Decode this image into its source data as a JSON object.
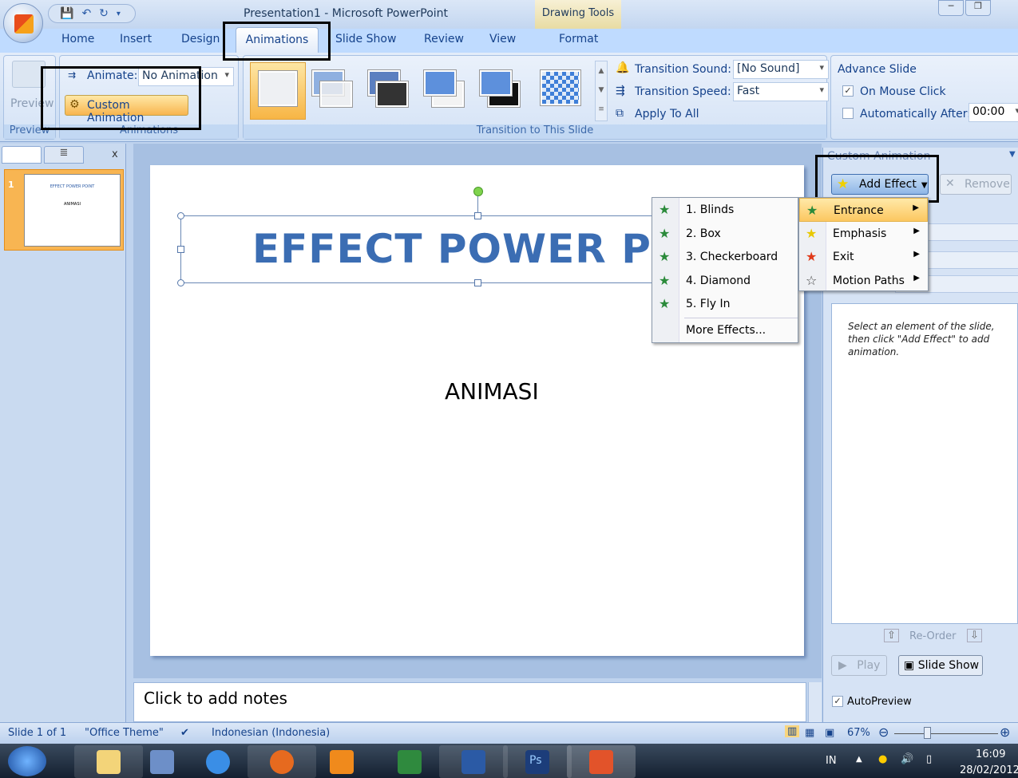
{
  "window": {
    "title": "Presentation1 - Microsoft PowerPoint",
    "contextual_tab_group": "Drawing Tools",
    "minimize": "─",
    "restore": "❐"
  },
  "tabs": [
    "Home",
    "Insert",
    "Design",
    "Animations",
    "Slide Show",
    "Review",
    "View",
    "Format"
  ],
  "active_tab": "Animations",
  "ribbon": {
    "preview": {
      "button": "Preview",
      "group": "Preview"
    },
    "animations": {
      "animate_label": "Animate:",
      "animate_value": "No Animation",
      "custom_animation": "Custom Animation",
      "group": "Animations"
    },
    "transition": {
      "sound_label": "Transition Sound:",
      "sound_value": "[No Sound]",
      "speed_label": "Transition Speed:",
      "speed_value": "Fast",
      "apply_all": "Apply To All",
      "group": "Transition to This Slide"
    },
    "advance": {
      "title": "Advance Slide",
      "on_mouse_click": "On Mouse Click",
      "on_mouse_click_checked": true,
      "auto_after": "Automatically After:",
      "auto_after_checked": false,
      "auto_time": "00:00"
    }
  },
  "slides_panel": {
    "close": "x",
    "slide_number": "1",
    "thumb_title": "EFFECT POWER POINT",
    "thumb_sub": "ANIMASI"
  },
  "slide": {
    "title": "EFFECT POWER POINT",
    "subtitle": "ANIMASI"
  },
  "notes": {
    "placeholder": "Click to add notes"
  },
  "task_pane": {
    "title": "Custom Animation",
    "add_effect": "Add Effect",
    "remove": "Remove",
    "hint": "Select an element of the slide, then click \"Add Effect\" to add animation.",
    "reorder": "Re-Order",
    "play": "Play",
    "slide_show": "Slide Show",
    "autopreview": "AutoPreview",
    "autopreview_checked": true
  },
  "add_effect_menu": [
    {
      "label": "Entrance",
      "icon": "green-star-icon",
      "highlighted": true
    },
    {
      "label": "Emphasis",
      "icon": "yellow-star-icon"
    },
    {
      "label": "Exit",
      "icon": "red-star-icon"
    },
    {
      "label": "Motion Paths",
      "icon": "outline-star-icon"
    }
  ],
  "entrance_submenu": [
    "1. Blinds",
    "2. Box",
    "3. Checkerboard",
    "4. Diamond",
    "5. Fly In",
    "More Effects..."
  ],
  "status": {
    "slide": "Slide 1 of 1",
    "theme": "\"Office Theme\"",
    "language": "Indonesian (Indonesia)",
    "zoom": "67%",
    "zoom_level": 67
  },
  "taskbar": {
    "lang": "IN",
    "time": "16:09",
    "date": "28/02/2012",
    "apps": [
      "windows-explorer",
      "user-app",
      "internet-explorer",
      "firefox",
      "media-player",
      "excel",
      "word",
      "photoshop",
      "powerpoint"
    ]
  },
  "colors": {
    "accent": "#15428b",
    "highlight": "#f8c46b",
    "ribbon": "#dbe7f7"
  }
}
